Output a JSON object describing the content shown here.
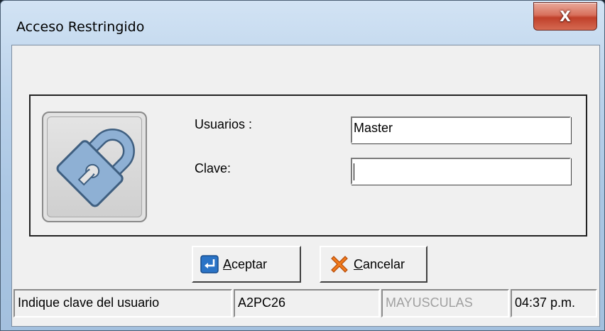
{
  "window": {
    "title": "Acceso Restringido",
    "close_glyph": "X"
  },
  "form": {
    "lock_icon": "padlock-icon",
    "user_label": "Usuarios :",
    "user_value": "Master",
    "password_label": "Clave:",
    "password_value": ""
  },
  "buttons": {
    "accept_mnemonic": "A",
    "accept_rest": "ceptar",
    "accept_icon": "enter-arrow-icon",
    "cancel_mnemonic": "C",
    "cancel_rest": "ancelar",
    "cancel_icon": "x-cross-icon"
  },
  "status_bar": {
    "message": "Indique clave del usuario",
    "machine": "A2PC26",
    "caps": "MAYUSCULAS",
    "time": "04:37 p.m."
  },
  "colors": {
    "lock_blue": "#8eb0d4",
    "close_red": "#c0402a",
    "cancel_orange": "#f07a1c",
    "accept_blue": "#2a73c6"
  }
}
